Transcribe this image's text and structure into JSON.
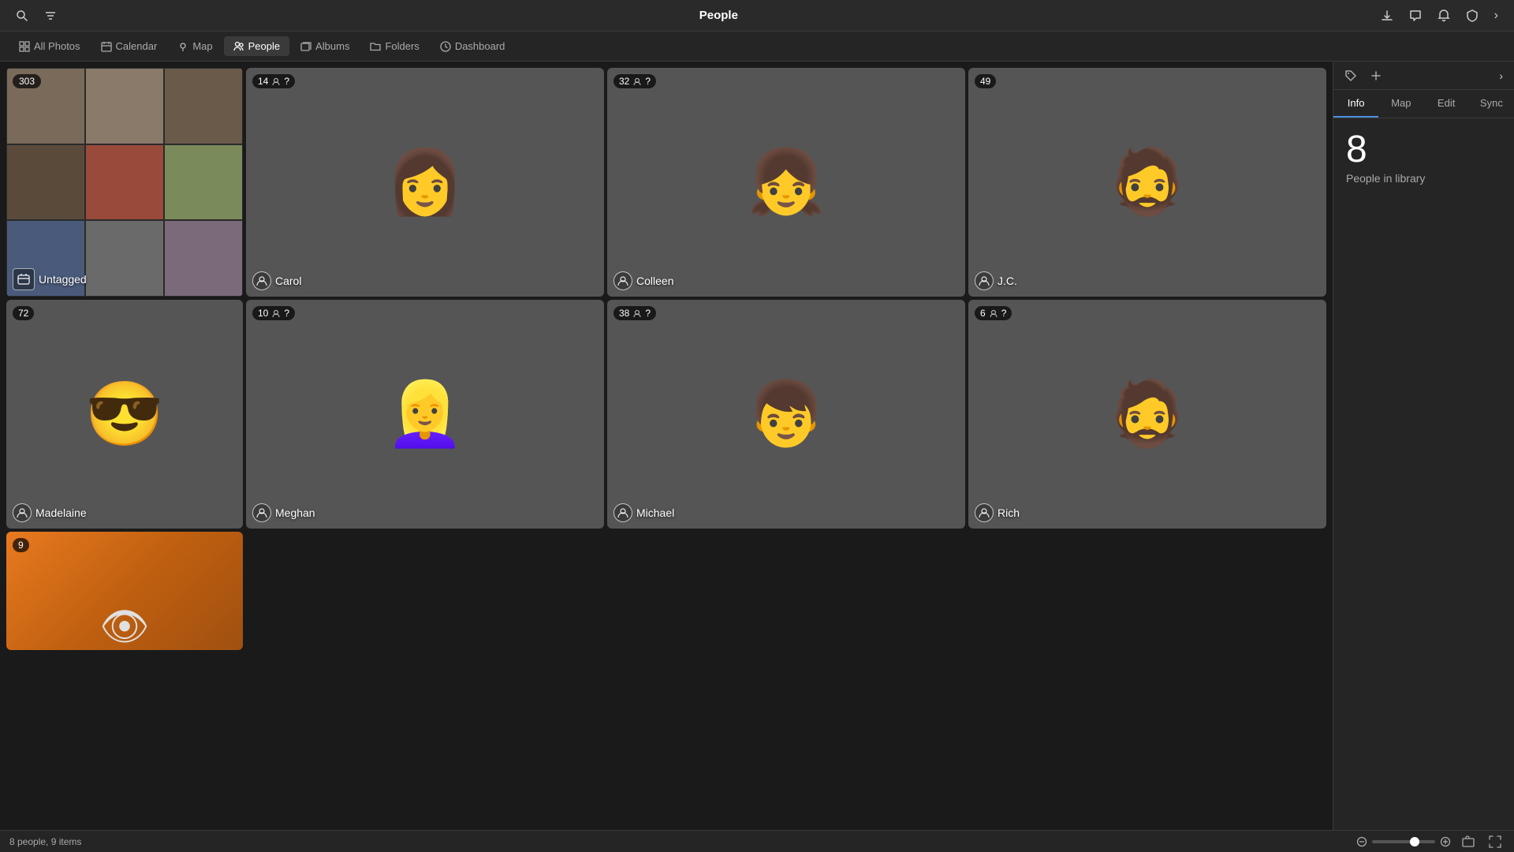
{
  "app": {
    "title": "People"
  },
  "topbar": {
    "search_icon": "🔍",
    "filter_icon": "⚡",
    "download_icon": "⬇",
    "chat_icon": "💬",
    "bell_icon": "🔔",
    "shield_icon": "🛡",
    "chevron_icon": "›"
  },
  "nav": {
    "tabs": [
      {
        "id": "all-photos",
        "label": "All Photos",
        "icon": "grid"
      },
      {
        "id": "calendar",
        "label": "Calendar",
        "icon": "calendar"
      },
      {
        "id": "map",
        "label": "Map",
        "icon": "map"
      },
      {
        "id": "people",
        "label": "People",
        "icon": "people",
        "active": true
      },
      {
        "id": "albums",
        "label": "Albums",
        "icon": "albums"
      },
      {
        "id": "folders",
        "label": "Folders",
        "icon": "folders"
      },
      {
        "id": "dashboard",
        "label": "Dashboard",
        "icon": "dashboard"
      }
    ]
  },
  "cards": {
    "untagged": {
      "badge": "303",
      "label": "Untagged"
    },
    "carol": {
      "badge": "14",
      "has_person_icon": true,
      "has_question": true,
      "label": "Carol"
    },
    "colleen": {
      "badge": "32",
      "has_person_icon": true,
      "has_question": true,
      "label": "Colleen"
    },
    "jc": {
      "badge": "49",
      "label": "J.C."
    },
    "madelaine": {
      "badge": "72",
      "label": "Madelaine"
    },
    "meghan": {
      "badge": "10",
      "has_person_icon": true,
      "has_question": true,
      "label": "Meghan"
    },
    "michael": {
      "badge": "38",
      "has_person_icon": true,
      "has_question": true,
      "label": "Michael"
    },
    "rich": {
      "badge": "6",
      "has_person_icon": true,
      "has_question": true,
      "label": "Rich"
    },
    "unknown9": {
      "badge": "9"
    }
  },
  "sidebar": {
    "tabs": [
      "Info",
      "Map",
      "Edit",
      "Sync"
    ],
    "active_tab": "Info",
    "info": {
      "count": "8",
      "label": "People in library"
    }
  },
  "bottom_bar": {
    "summary": "8 people, 9 items"
  }
}
